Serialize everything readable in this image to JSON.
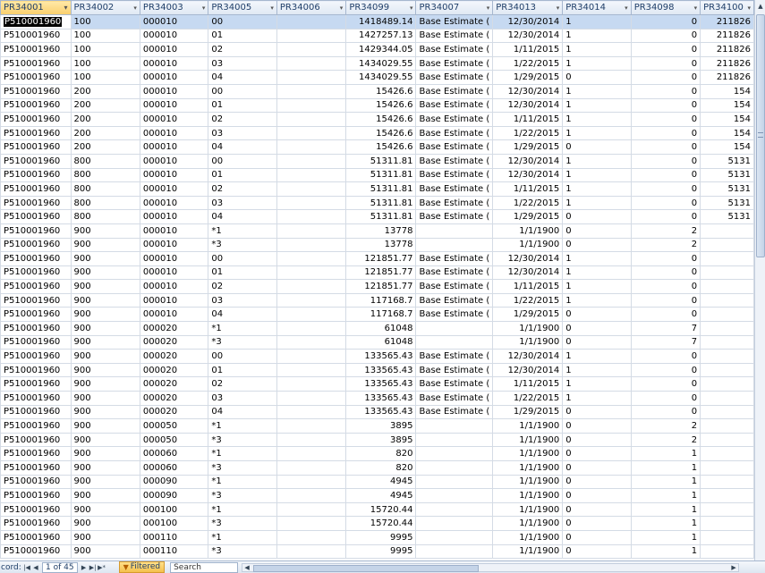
{
  "columns": [
    {
      "label": "PR34001",
      "type": "text"
    },
    {
      "label": "PR34002",
      "type": "text"
    },
    {
      "label": "PR34003",
      "type": "text"
    },
    {
      "label": "PR34005",
      "type": "text"
    },
    {
      "label": "PR34006",
      "type": "text"
    },
    {
      "label": "PR34099",
      "type": "num"
    },
    {
      "label": "PR34007",
      "type": "text"
    },
    {
      "label": "PR34013",
      "type": "num"
    },
    {
      "label": "PR34014",
      "type": "text"
    },
    {
      "label": "PR34098",
      "type": "num"
    },
    {
      "label": "PR34100",
      "type": "num"
    }
  ],
  "rows": [
    [
      "P510001960",
      "100",
      "000010",
      "00",
      "",
      "1418489.14",
      "Base Estimate (",
      "12/30/2014",
      "1",
      "0",
      "211826"
    ],
    [
      "P510001960",
      "100",
      "000010",
      "01",
      "",
      "1427257.13",
      "Base Estimate (",
      "12/30/2014",
      "1",
      "0",
      "211826"
    ],
    [
      "P510001960",
      "100",
      "000010",
      "02",
      "",
      "1429344.05",
      "Base Estimate (",
      "1/11/2015",
      "1",
      "0",
      "211826"
    ],
    [
      "P510001960",
      "100",
      "000010",
      "03",
      "",
      "1434029.55",
      "Base Estimate (",
      "1/22/2015",
      "1",
      "0",
      "211826"
    ],
    [
      "P510001960",
      "100",
      "000010",
      "04",
      "",
      "1434029.55",
      "Base Estimate (",
      "1/29/2015",
      "0",
      "0",
      "211826"
    ],
    [
      "P510001960",
      "200",
      "000010",
      "00",
      "",
      "15426.6",
      "Base Estimate (",
      "12/30/2014",
      "1",
      "0",
      "154"
    ],
    [
      "P510001960",
      "200",
      "000010",
      "01",
      "",
      "15426.6",
      "Base Estimate (",
      "12/30/2014",
      "1",
      "0",
      "154"
    ],
    [
      "P510001960",
      "200",
      "000010",
      "02",
      "",
      "15426.6",
      "Base Estimate (",
      "1/11/2015",
      "1",
      "0",
      "154"
    ],
    [
      "P510001960",
      "200",
      "000010",
      "03",
      "",
      "15426.6",
      "Base Estimate (",
      "1/22/2015",
      "1",
      "0",
      "154"
    ],
    [
      "P510001960",
      "200",
      "000010",
      "04",
      "",
      "15426.6",
      "Base Estimate (",
      "1/29/2015",
      "0",
      "0",
      "154"
    ],
    [
      "P510001960",
      "800",
      "000010",
      "00",
      "",
      "51311.81",
      "Base Estimate (",
      "12/30/2014",
      "1",
      "0",
      "5131"
    ],
    [
      "P510001960",
      "800",
      "000010",
      "01",
      "",
      "51311.81",
      "Base Estimate (",
      "12/30/2014",
      "1",
      "0",
      "5131"
    ],
    [
      "P510001960",
      "800",
      "000010",
      "02",
      "",
      "51311.81",
      "Base Estimate (",
      "1/11/2015",
      "1",
      "0",
      "5131"
    ],
    [
      "P510001960",
      "800",
      "000010",
      "03",
      "",
      "51311.81",
      "Base Estimate (",
      "1/22/2015",
      "1",
      "0",
      "5131"
    ],
    [
      "P510001960",
      "800",
      "000010",
      "04",
      "",
      "51311.81",
      "Base Estimate (",
      "1/29/2015",
      "0",
      "0",
      "5131"
    ],
    [
      "P510001960",
      "900",
      "000010",
      "*1",
      "",
      "13778",
      "",
      "1/1/1900",
      "0",
      "2",
      ""
    ],
    [
      "P510001960",
      "900",
      "000010",
      "*3",
      "",
      "13778",
      "",
      "1/1/1900",
      "0",
      "2",
      ""
    ],
    [
      "P510001960",
      "900",
      "000010",
      "00",
      "",
      "121851.77",
      "Base Estimate (",
      "12/30/2014",
      "1",
      "0",
      ""
    ],
    [
      "P510001960",
      "900",
      "000010",
      "01",
      "",
      "121851.77",
      "Base Estimate (",
      "12/30/2014",
      "1",
      "0",
      ""
    ],
    [
      "P510001960",
      "900",
      "000010",
      "02",
      "",
      "121851.77",
      "Base Estimate (",
      "1/11/2015",
      "1",
      "0",
      ""
    ],
    [
      "P510001960",
      "900",
      "000010",
      "03",
      "",
      "117168.7",
      "Base Estimate (",
      "1/22/2015",
      "1",
      "0",
      ""
    ],
    [
      "P510001960",
      "900",
      "000010",
      "04",
      "",
      "117168.7",
      "Base Estimate (",
      "1/29/2015",
      "0",
      "0",
      ""
    ],
    [
      "P510001960",
      "900",
      "000020",
      "*1",
      "",
      "61048",
      "",
      "1/1/1900",
      "0",
      "7",
      ""
    ],
    [
      "P510001960",
      "900",
      "000020",
      "*3",
      "",
      "61048",
      "",
      "1/1/1900",
      "0",
      "7",
      ""
    ],
    [
      "P510001960",
      "900",
      "000020",
      "00",
      "",
      "133565.43",
      "Base Estimate (",
      "12/30/2014",
      "1",
      "0",
      ""
    ],
    [
      "P510001960",
      "900",
      "000020",
      "01",
      "",
      "133565.43",
      "Base Estimate (",
      "12/30/2014",
      "1",
      "0",
      ""
    ],
    [
      "P510001960",
      "900",
      "000020",
      "02",
      "",
      "133565.43",
      "Base Estimate (",
      "1/11/2015",
      "1",
      "0",
      ""
    ],
    [
      "P510001960",
      "900",
      "000020",
      "03",
      "",
      "133565.43",
      "Base Estimate (",
      "1/22/2015",
      "1",
      "0",
      ""
    ],
    [
      "P510001960",
      "900",
      "000020",
      "04",
      "",
      "133565.43",
      "Base Estimate (",
      "1/29/2015",
      "0",
      "0",
      ""
    ],
    [
      "P510001960",
      "900",
      "000050",
      "*1",
      "",
      "3895",
      "",
      "1/1/1900",
      "0",
      "2",
      ""
    ],
    [
      "P510001960",
      "900",
      "000050",
      "*3",
      "",
      "3895",
      "",
      "1/1/1900",
      "0",
      "2",
      ""
    ],
    [
      "P510001960",
      "900",
      "000060",
      "*1",
      "",
      "820",
      "",
      "1/1/1900",
      "0",
      "1",
      ""
    ],
    [
      "P510001960",
      "900",
      "000060",
      "*3",
      "",
      "820",
      "",
      "1/1/1900",
      "0",
      "1",
      ""
    ],
    [
      "P510001960",
      "900",
      "000090",
      "*1",
      "",
      "4945",
      "",
      "1/1/1900",
      "0",
      "1",
      ""
    ],
    [
      "P510001960",
      "900",
      "000090",
      "*3",
      "",
      "4945",
      "",
      "1/1/1900",
      "0",
      "1",
      ""
    ],
    [
      "P510001960",
      "900",
      "000100",
      "*1",
      "",
      "15720.44",
      "",
      "1/1/1900",
      "0",
      "1",
      ""
    ],
    [
      "P510001960",
      "900",
      "000100",
      "*3",
      "",
      "15720.44",
      "",
      "1/1/1900",
      "0",
      "1",
      ""
    ],
    [
      "P510001960",
      "900",
      "000110",
      "*1",
      "",
      "9995",
      "",
      "1/1/1900",
      "0",
      "1",
      ""
    ],
    [
      "P510001960",
      "900",
      "000110",
      "*3",
      "",
      "9995",
      "",
      "1/1/1900",
      "0",
      "1",
      ""
    ]
  ],
  "navbar": {
    "record_label": "cord:",
    "position": "1 of 45",
    "filtered_label": "Filtered",
    "search_label": "Search"
  },
  "colors": {
    "header_bg": "#dfe8f3",
    "sorted_header_bg": "#f9cf6c",
    "selected_row": "#c6d9f1",
    "grid_line": "#d4dbe5"
  }
}
